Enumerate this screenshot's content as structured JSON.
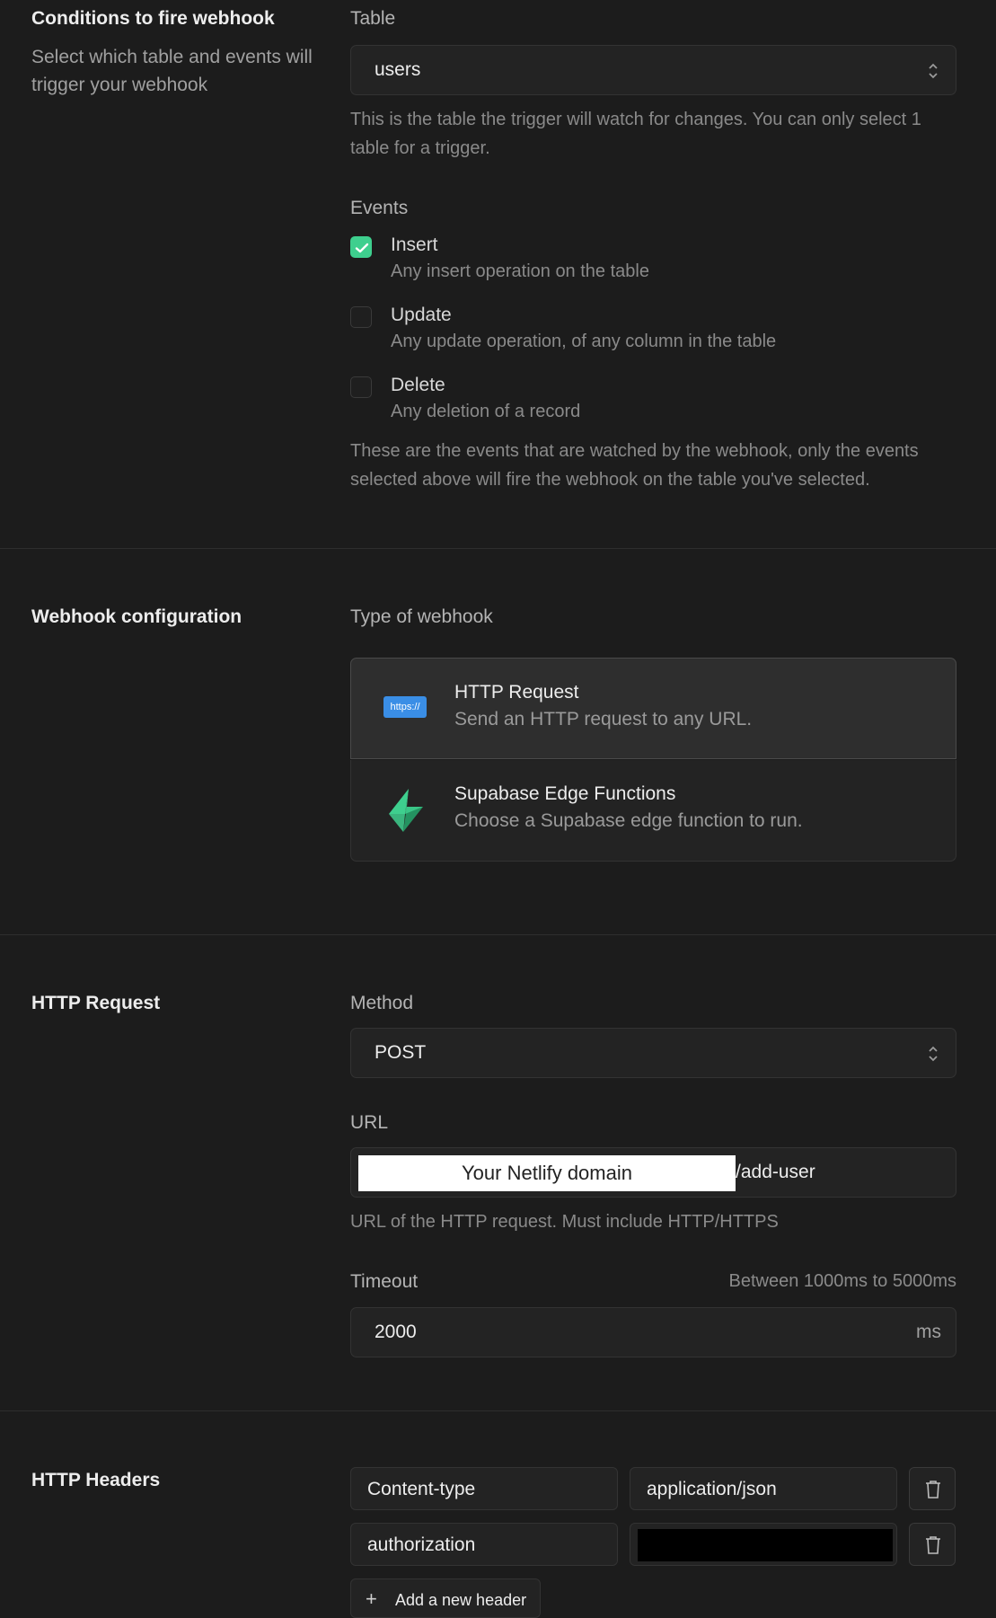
{
  "conditions": {
    "title": "Conditions to fire webhook",
    "description": "Select which table and events will trigger your webhook",
    "table_label": "Table",
    "table_value": "users",
    "table_help": "This is the table the trigger will watch for changes. You can only select 1 table for a trigger.",
    "events_label": "Events",
    "events": [
      {
        "title": "Insert",
        "description": "Any insert operation on the table",
        "checked": true
      },
      {
        "title": "Update",
        "description": "Any update operation, of any column in the table",
        "checked": false
      },
      {
        "title": "Delete",
        "description": "Any deletion of a record",
        "checked": false
      }
    ],
    "events_help": "These are the events that are watched by the webhook, only the events selected above will fire the webhook on the table you've selected."
  },
  "webhook_config": {
    "title": "Webhook configuration",
    "type_label": "Type of webhook",
    "types": [
      {
        "title": "HTTP Request",
        "description": "Send an HTTP request to any URL.",
        "badge": "https://",
        "icon": "https-badge-icon",
        "selected": true
      },
      {
        "title": "Supabase Edge Functions",
        "description": "Choose a Supabase edge function to run.",
        "icon": "supabase-bolt-icon",
        "selected": false
      }
    ]
  },
  "http_request": {
    "title": "HTTP Request",
    "method_label": "Method",
    "method_value": "POST",
    "url_label": "URL",
    "url_redacted_text": "Your Netlify domain",
    "url_suffix": "/add-user",
    "url_help": "URL of the HTTP request. Must include HTTP/HTTPS",
    "timeout_label": "Timeout",
    "timeout_range": "Between 1000ms to 5000ms",
    "timeout_value": "2000",
    "timeout_unit": "ms"
  },
  "http_headers": {
    "title": "HTTP Headers",
    "rows": [
      {
        "name": "Content-type",
        "value": "application/json",
        "value_redacted": false
      },
      {
        "name": "authorization",
        "value": "",
        "value_redacted": true
      }
    ],
    "add_label": "Add a new header"
  },
  "colors": {
    "background": "#1c1c1c",
    "accent_green": "#3ecf8e",
    "badge_blue": "#3a8ee6"
  }
}
